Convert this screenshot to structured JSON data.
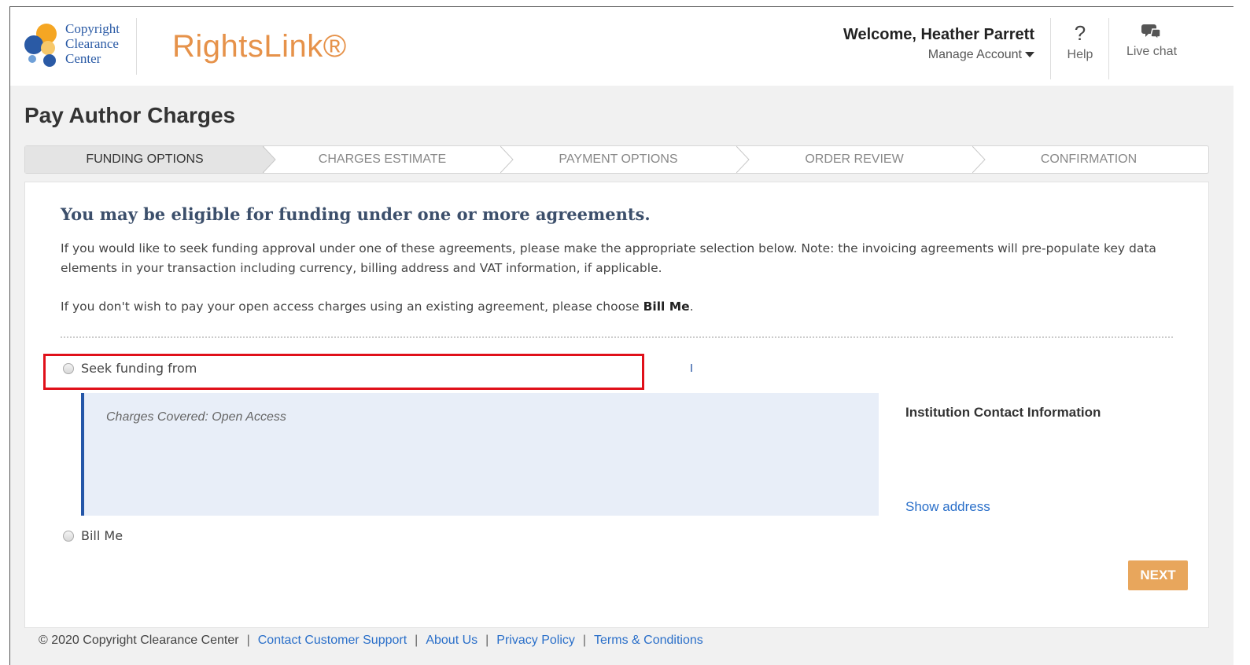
{
  "header": {
    "logo_text": [
      "Copyright",
      "Clearance",
      "Center"
    ],
    "brand": "RightsLink®",
    "welcome": "Welcome, Heather Parrett",
    "manage_account": "Manage Account",
    "help_icon": "question-mark-icon",
    "help_label": "Help",
    "chat_icon": "chat-bubbles-icon",
    "chat_label": "Live chat"
  },
  "page": {
    "title": "Pay Author Charges"
  },
  "steps": [
    {
      "label": "FUNDING OPTIONS",
      "active": true
    },
    {
      "label": "CHARGES ESTIMATE",
      "active": false
    },
    {
      "label": "PAYMENT OPTIONS",
      "active": false
    },
    {
      "label": "ORDER REVIEW",
      "active": false
    },
    {
      "label": "CONFIRMATION",
      "active": false
    }
  ],
  "main": {
    "heading": "You may be eligible for funding under one or more agreements.",
    "paragraph1": "If you would like to seek funding approval under one of these agreements, please make the appropriate selection below. Note: the invoicing agreements will pre-populate key data elements in your transaction including currency, billing address and VAT information, if applicable.",
    "paragraph2_prefix": "If you don't wish to pay your open access charges using an existing agreement, please choose ",
    "paragraph2_bold": "Bill Me",
    "paragraph2_suffix": ".",
    "option_seek": "Seek funding from",
    "charges_covered": "Charges Covered: Open Access",
    "institution_title": "Institution Contact Information",
    "show_address": "Show address",
    "option_bill": "Bill Me",
    "next_label": "NEXT"
  },
  "footer": {
    "copyright": "© 2020 Copyright Clearance Center",
    "links": [
      "Contact Customer Support",
      "About Us",
      "Privacy Policy",
      "Terms & Conditions"
    ]
  },
  "colors": {
    "brand_orange": "#e6924a",
    "link_blue": "#2a6fc9",
    "next_button": "#e8a65c",
    "highlight_red": "#e0101a",
    "info_box_bg": "#e8eef8"
  }
}
